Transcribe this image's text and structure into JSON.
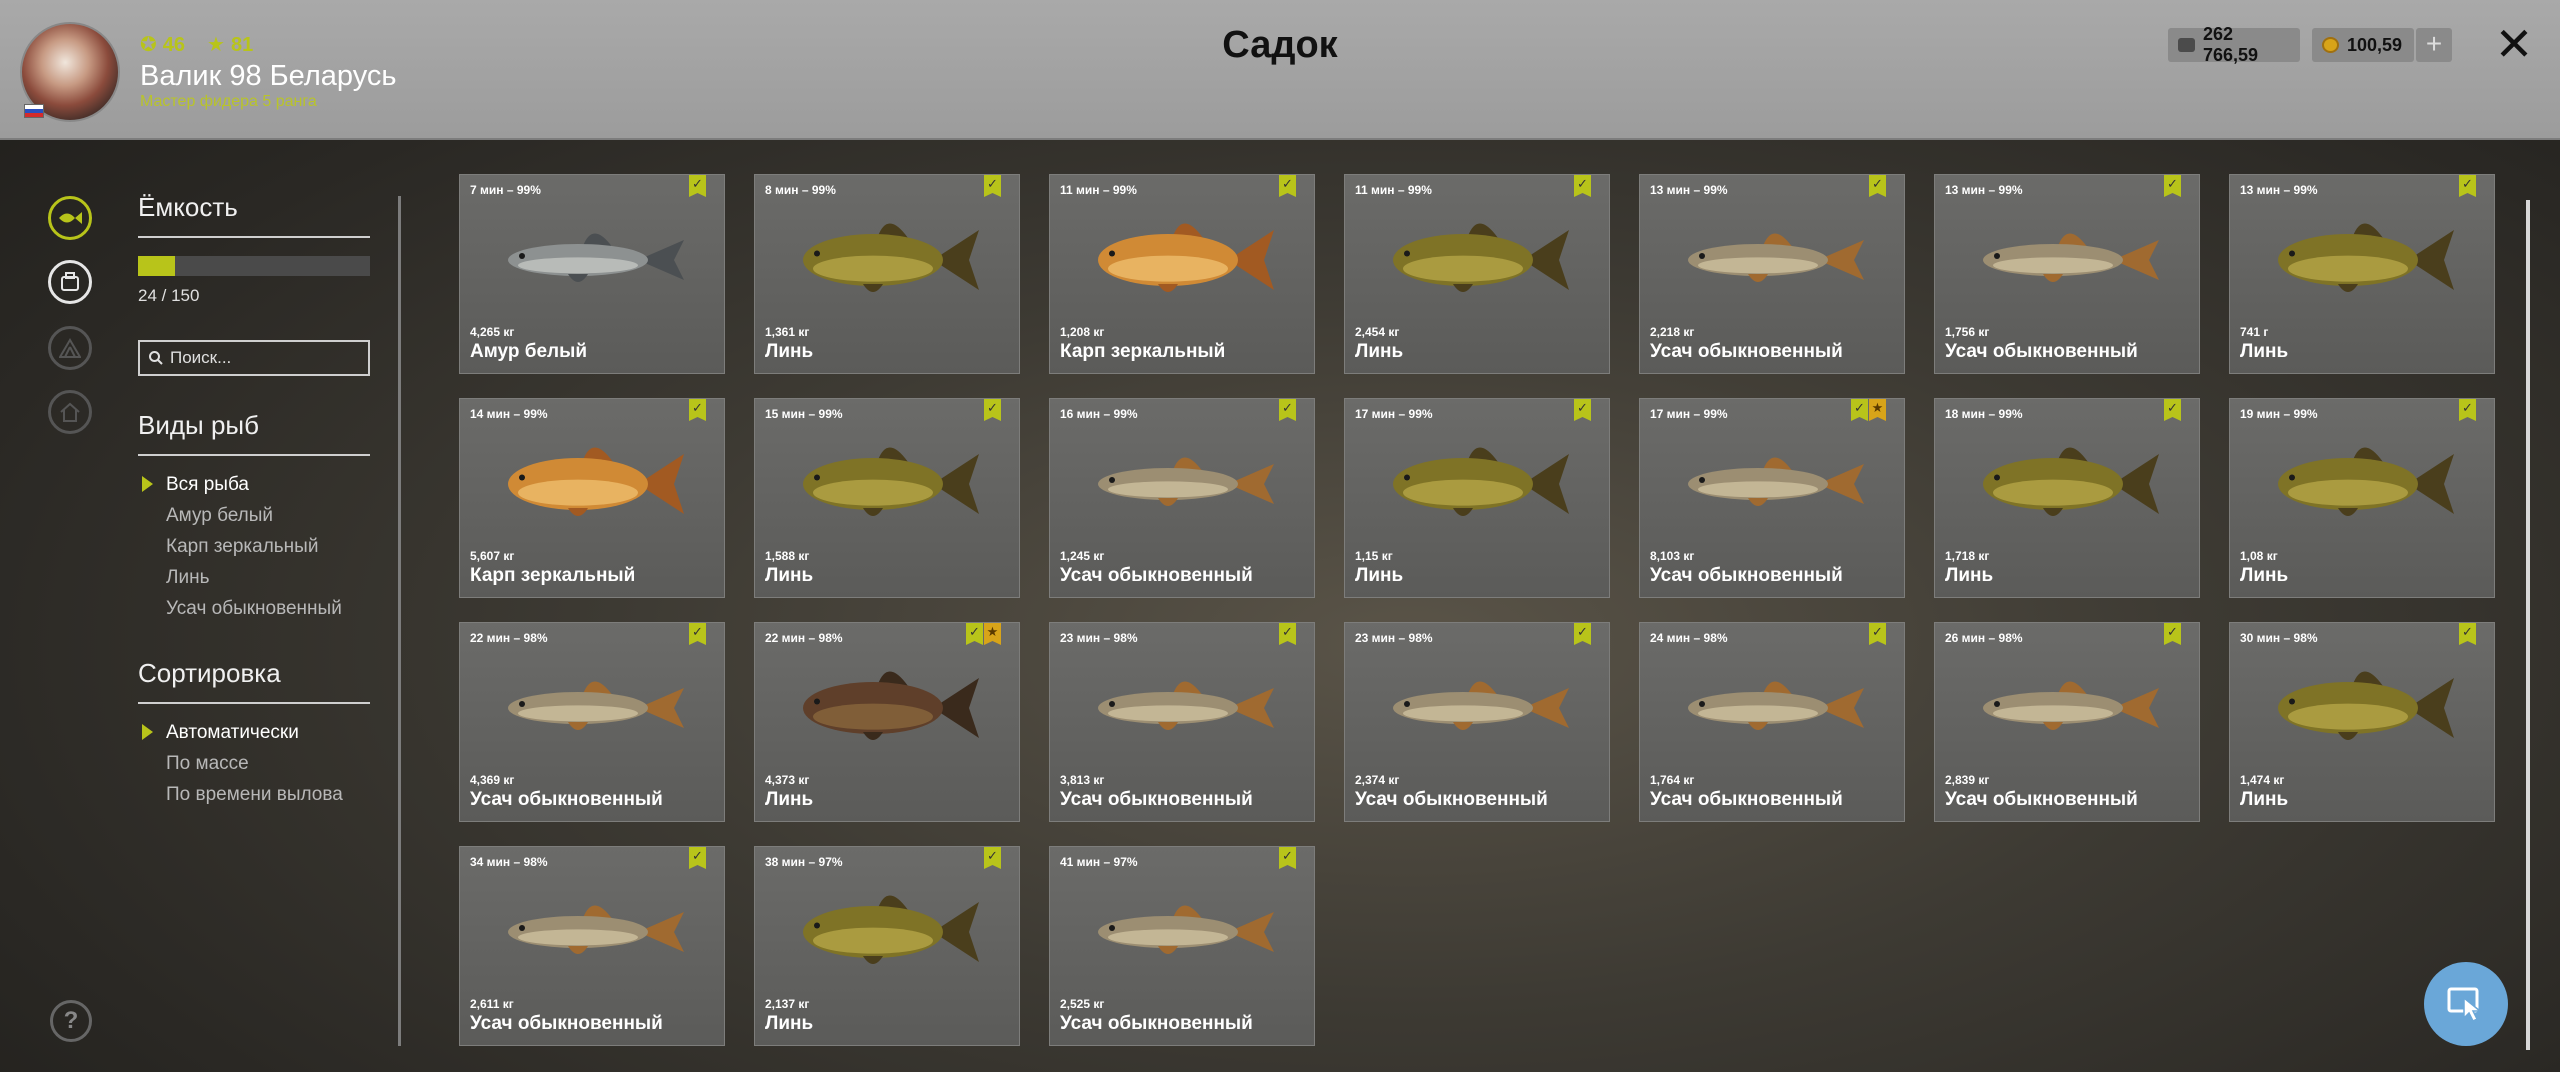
{
  "header": {
    "title": "Садок",
    "player_name": "Валик 98 Беларусь",
    "player_rank": "Мастер фидера 5 ранга",
    "level": "46",
    "stars": "81",
    "silver": "262 766,59",
    "gold": "100,59",
    "plus": "+",
    "close": "✕"
  },
  "panel": {
    "capacity_title": "Ёмкость",
    "capacity_text": "24 / 150",
    "capacity_fraction": 0.16,
    "search_placeholder": "Поиск...",
    "species_title": "Виды рыб",
    "species": [
      "Вся рыба",
      "Амур белый",
      "Карп зеркальный",
      "Линь",
      "Усач обыкновенный"
    ],
    "sort_title": "Сортировка",
    "sorts": [
      "Автоматически",
      "По массе",
      "По времени вылова"
    ]
  },
  "colors": {
    "accent": "#b8c41a",
    "gold": "#d8a419",
    "fab": "#6aa7d8"
  },
  "fish": [
    {
      "time": "7 мин – 99%",
      "weight": "4,265 кг",
      "name": "Амур белый",
      "kind": "amur",
      "star": false
    },
    {
      "time": "8 мин – 99%",
      "weight": "1,361 кг",
      "name": "Линь",
      "kind": "tench",
      "star": false
    },
    {
      "time": "11 мин – 99%",
      "weight": "1,208 кг",
      "name": "Карп зеркальный",
      "kind": "carp",
      "star": false
    },
    {
      "time": "11 мин – 99%",
      "weight": "2,454 кг",
      "name": "Линь",
      "kind": "tench",
      "star": false
    },
    {
      "time": "13 мин – 99%",
      "weight": "2,218 кг",
      "name": "Усач обыкновенный",
      "kind": "barbel",
      "star": false
    },
    {
      "time": "13 мин – 99%",
      "weight": "1,756 кг",
      "name": "Усач обыкновенный",
      "kind": "barbel",
      "star": false
    },
    {
      "time": "13 мин – 99%",
      "weight": "741 г",
      "name": "Линь",
      "kind": "tench",
      "star": false
    },
    {
      "time": "14 мин – 99%",
      "weight": "5,607 кг",
      "name": "Карп зеркальный",
      "kind": "carp",
      "star": false
    },
    {
      "time": "15 мин – 99%",
      "weight": "1,588 кг",
      "name": "Линь",
      "kind": "tench",
      "star": false
    },
    {
      "time": "16 мин – 99%",
      "weight": "1,245 кг",
      "name": "Усач обыкновенный",
      "kind": "barbel",
      "star": false
    },
    {
      "time": "17 мин – 99%",
      "weight": "1,15 кг",
      "name": "Линь",
      "kind": "tench",
      "star": false
    },
    {
      "time": "17 мин – 99%",
      "weight": "8,103 кг",
      "name": "Усач обыкновенный",
      "kind": "barbel",
      "star": true
    },
    {
      "time": "18 мин – 99%",
      "weight": "1,718 кг",
      "name": "Линь",
      "kind": "tench",
      "star": false
    },
    {
      "time": "19 мин – 99%",
      "weight": "1,08 кг",
      "name": "Линь",
      "kind": "tench",
      "star": false
    },
    {
      "time": "22 мин – 98%",
      "weight": "4,369 кг",
      "name": "Усач обыкновенный",
      "kind": "barbel",
      "star": false
    },
    {
      "time": "22 мин – 98%",
      "weight": "4,373 кг",
      "name": "Линь",
      "kind": "tench-dark",
      "star": true
    },
    {
      "time": "23 мин – 98%",
      "weight": "3,813 кг",
      "name": "Усач обыкновенный",
      "kind": "barbel",
      "star": false
    },
    {
      "time": "23 мин – 98%",
      "weight": "2,374 кг",
      "name": "Усач обыкновенный",
      "kind": "barbel",
      "star": false
    },
    {
      "time": "24 мин – 98%",
      "weight": "1,764 кг",
      "name": "Усач обыкновенный",
      "kind": "barbel",
      "star": false
    },
    {
      "time": "26 мин – 98%",
      "weight": "2,839 кг",
      "name": "Усач обыкновенный",
      "kind": "barbel",
      "star": false
    },
    {
      "time": "30 мин – 98%",
      "weight": "1,474 кг",
      "name": "Линь",
      "kind": "tench",
      "star": false
    },
    {
      "time": "34 мин – 98%",
      "weight": "2,611 кг",
      "name": "Усач обыкновенный",
      "kind": "barbel",
      "star": false
    },
    {
      "time": "38 мин – 97%",
      "weight": "2,137 кг",
      "name": "Линь",
      "kind": "tench",
      "star": false
    },
    {
      "time": "41 мин – 97%",
      "weight": "2,525 кг",
      "name": "Усач обыкновенный",
      "kind": "barbel",
      "star": false
    }
  ]
}
